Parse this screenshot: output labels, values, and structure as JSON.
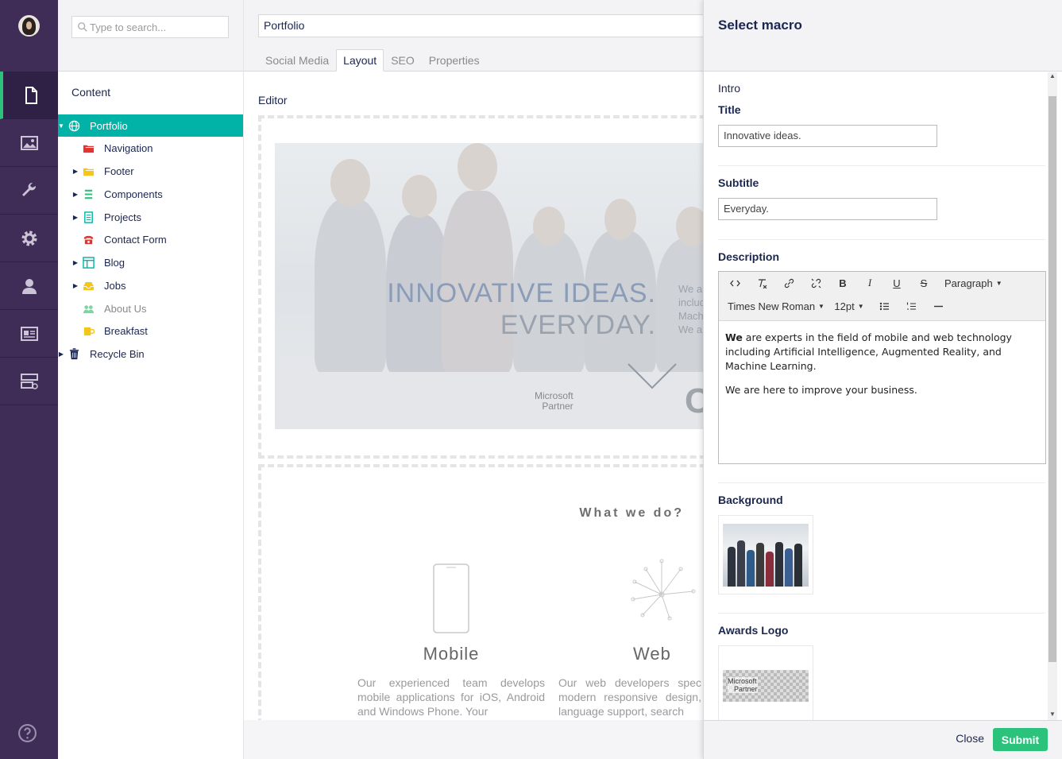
{
  "search": {
    "placeholder": "Type to search..."
  },
  "tree": {
    "heading": "Content",
    "nodes": [
      {
        "label": "Portfolio",
        "icon": "globe-icon",
        "color": "#ffffff"
      },
      {
        "label": "Navigation",
        "icon": "folder-icon",
        "color": "#e3342f"
      },
      {
        "label": "Footer",
        "icon": "folder-icon",
        "color": "#f5c518"
      },
      {
        "label": "Components",
        "icon": "list-icon",
        "color": "#2bc37c"
      },
      {
        "label": "Projects",
        "icon": "document-list-icon",
        "color": "#00b3a6"
      },
      {
        "label": "Contact Form",
        "icon": "phone-icon",
        "color": "#e3342f"
      },
      {
        "label": "Blog",
        "icon": "layout-icon",
        "color": "#00b3a6"
      },
      {
        "label": "Jobs",
        "icon": "inbox-icon",
        "color": "#f5c518"
      },
      {
        "label": "About Us",
        "icon": "users-icon",
        "color": "#7fd3a8"
      },
      {
        "label": "Breakfast",
        "icon": "mug-icon",
        "color": "#f5c518"
      },
      {
        "label": "Recycle Bin",
        "icon": "trash-icon",
        "color": "#1b264f"
      }
    ]
  },
  "editor": {
    "name": "Portfolio",
    "tabs": [
      "Social Media",
      "Layout",
      "SEO",
      "Properties"
    ],
    "active_tab": "Layout",
    "section_label": "Editor",
    "hero": {
      "line1": "INNOVATIVE IDEAS.",
      "line2": "EVERYDAY.",
      "side1": "We are e",
      "side2": "including",
      "side3": "Machine",
      "side4": "We are h",
      "ms1": "Microsoft",
      "ms2": "Partner",
      "cl": "Cl"
    },
    "what_heading": "What we do?",
    "columns": [
      {
        "title": "Mobile",
        "text": "Our experienced team develops mobile applications for iOS, Android and Windows Phone. Your"
      },
      {
        "title": "Web",
        "text": "Our web developers spec modern responsive design, language support, search"
      }
    ]
  },
  "macro": {
    "title": "Select macro",
    "group": "Intro",
    "title_label": "Title",
    "title_value": "Innovative ideas.",
    "subtitle_label": "Subtitle",
    "subtitle_value": "Everyday.",
    "description_label": "Description",
    "toolbar": {
      "format": "Paragraph",
      "font": "Times New Roman",
      "size": "12pt"
    },
    "description_bold": "We",
    "description_p1": " are experts in the field of mobile and web technology including Artificial Intelligence, Augmented Reality, and Machine Learning.",
    "description_p2": "We are here to improve your business.",
    "background_label": "Background",
    "awards_label": "Awards Logo",
    "awards_logo_text1": "Microsoft",
    "awards_logo_text2": "Partner",
    "close_label": "Close",
    "submit_label": "Submit"
  },
  "colors": {
    "sidebar": "#3f2d58",
    "accent": "#00b3a6",
    "submit": "#2bc37c"
  }
}
